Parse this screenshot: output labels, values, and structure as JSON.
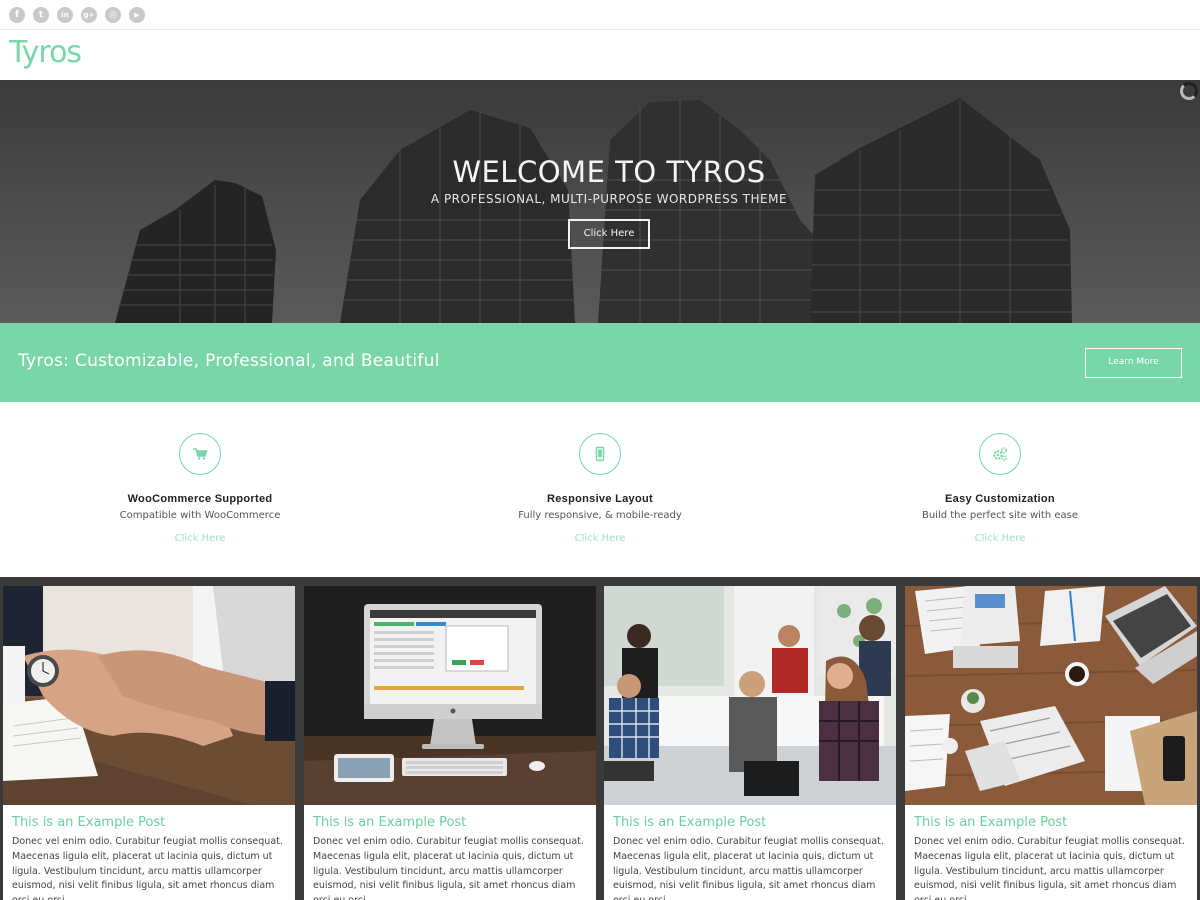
{
  "social": {
    "icons": [
      "facebook-icon",
      "twitter-icon",
      "linkedin-icon",
      "google-plus-icon",
      "instagram-icon",
      "youtube-icon"
    ],
    "glyphs": [
      "f",
      "t",
      "in",
      "g+",
      "◎",
      "▶"
    ]
  },
  "header": {
    "logo": "Tyros"
  },
  "hero": {
    "title": "WELCOME TO TYROS",
    "subtitle": "A PROFESSIONAL, MULTI-PURPOSE WORDPRESS THEME",
    "button": "Click Here"
  },
  "banner": {
    "text": "Tyros: Customizable, Professional, and Beautiful",
    "button": "Learn More"
  },
  "features": [
    {
      "icon": "cart-icon",
      "title": "WooCommerce Supported",
      "desc": "Compatible with WooCommerce",
      "link": "Click Here"
    },
    {
      "icon": "mobile-icon",
      "title": "Responsive Layout",
      "desc": "Fully responsive, & mobile-ready",
      "link": "Click Here"
    },
    {
      "icon": "gears-icon",
      "title": "Easy Customization",
      "desc": "Build the perfect site with ease",
      "link": "Click Here"
    }
  ],
  "posts": [
    {
      "image": "handshake-image",
      "title": "This is an Example Post",
      "body": "Donec vel enim odio. Curabitur feugiat mollis consequat. Maecenas ligula elit, placerat ut lacinia quis, dictum ut ligula. Vestibulum tincidunt, arcu mattis ullamcorper euismod, nisi velit finibus ligula, sit amet rhoncus diam orci eu orci."
    },
    {
      "image": "desktop-computer-image",
      "title": "This is an Example Post",
      "body": "Donec vel enim odio. Curabitur feugiat mollis consequat. Maecenas ligula elit, placerat ut lacinia quis, dictum ut ligula. Vestibulum tincidunt, arcu mattis ullamcorper euismod, nisi velit finibus ligula, sit amet rhoncus diam orci eu orci."
    },
    {
      "image": "office-meeting-image",
      "title": "This is an Example Post",
      "body": "Donec vel enim odio. Curabitur feugiat mollis consequat. Maecenas ligula elit, placerat ut lacinia quis, dictum ut ligula. Vestibulum tincidunt, arcu mattis ullamcorper euismod, nisi velit finibus ligula, sit amet rhoncus diam orci eu orci."
    },
    {
      "image": "business-desk-image",
      "title": "This is an Example Post",
      "body": "Donec vel enim odio. Curabitur feugiat mollis consequat. Maecenas ligula elit, placerat ut lacinia quis, dictum ut ligula. Vestibulum tincidunt, arcu mattis ullamcorper euismod, nisi velit finibus ligula, sit amet rhoncus diam orci eu orci."
    }
  ],
  "colors": {
    "accent": "#78d6a8",
    "post_title": "#6ccf9c",
    "dark_band": "#3a3a3a"
  }
}
